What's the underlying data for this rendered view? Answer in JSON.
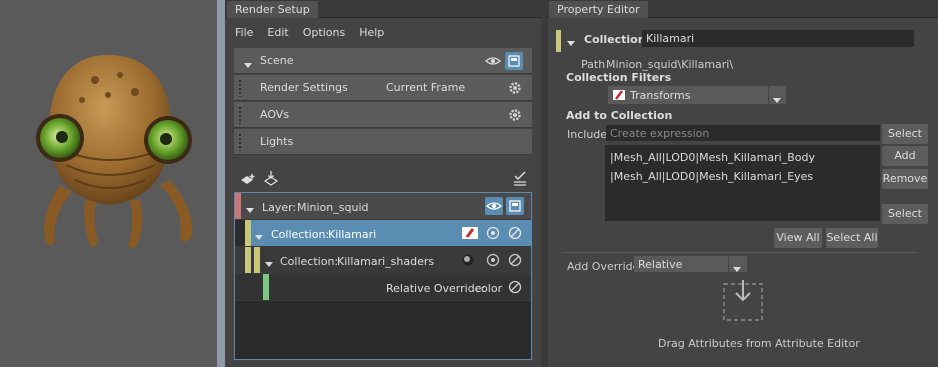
{
  "render_setup": {
    "tab": "Render Setup",
    "menu": [
      "File",
      "Edit",
      "Options",
      "Help"
    ],
    "scene_label": "Scene",
    "render_settings_label": "Render Settings",
    "render_settings_value": "Current Frame",
    "aovs_label": "AOVs",
    "lights_label": "Lights",
    "layer": {
      "prefix": "Layer:",
      "name": "Minion_squid"
    },
    "collection": {
      "prefix": "Collection:",
      "name": "Killamari"
    },
    "sub_collection": {
      "prefix": "Collection:",
      "name": "Killamari_shaders"
    },
    "override": {
      "prefix": "Relative Override:",
      "name": "color"
    }
  },
  "property_editor": {
    "tab": "Property Editor",
    "collection_label": "Collection:",
    "collection_name": "Killamari",
    "path_label": "Path",
    "path_value": "Minion_squid\\Killamari\\",
    "filters_heading": "Collection Filters",
    "filter_value": "Transforms",
    "add_heading": "Add to Collection",
    "include_label": "Include",
    "include_placeholder": "Create expression",
    "select_label": "Select",
    "members": [
      "|Mesh_All|LOD0|Mesh_Killamari_Body",
      "|Mesh_All|LOD0|Mesh_Killamari_Eyes"
    ],
    "add_label": "Add",
    "remove_label": "Remove",
    "select2_label": "Select",
    "view_all_label": "View All",
    "select_all_label": "Select All",
    "add_override_label": "Add Override",
    "override_value": "Relative",
    "drag_hint": "Drag Attributes from Attribute Editor"
  },
  "colors": {
    "layer_stripe": "#c87575",
    "collection_stripe": "#c8c87a",
    "override_stripe": "#7ac882",
    "selection": "#5b8db3",
    "toggle_on": "#5b8db3"
  }
}
